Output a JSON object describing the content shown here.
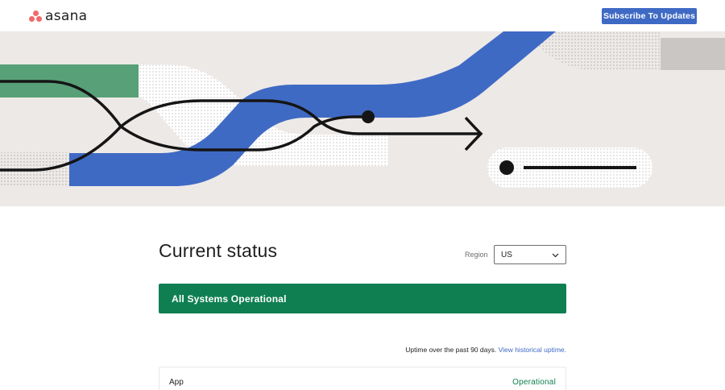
{
  "header": {
    "logo_text": "asana",
    "logo_icon": "asana-dots-logo-icon",
    "subscribe_label": "Subscribe To Updates"
  },
  "hero": {
    "illustration": "abstract-paths-arrow-illustration"
  },
  "main": {
    "title": "Current status",
    "region": {
      "label": "Region",
      "selected": "US",
      "icon": "chevron-down-icon"
    },
    "banner": {
      "text": "All Systems Operational"
    },
    "uptime": {
      "text": "Uptime over the past 90 days.",
      "link": "View historical uptime."
    },
    "components": [
      {
        "name": "App",
        "status": "Operational"
      }
    ]
  },
  "colors": {
    "brand_coral": "#f06a6a",
    "button_blue": "#3f6ac4",
    "status_green": "#0f7f52",
    "hero_bg": "#ede9e7",
    "link_blue": "#3f6ac4"
  }
}
